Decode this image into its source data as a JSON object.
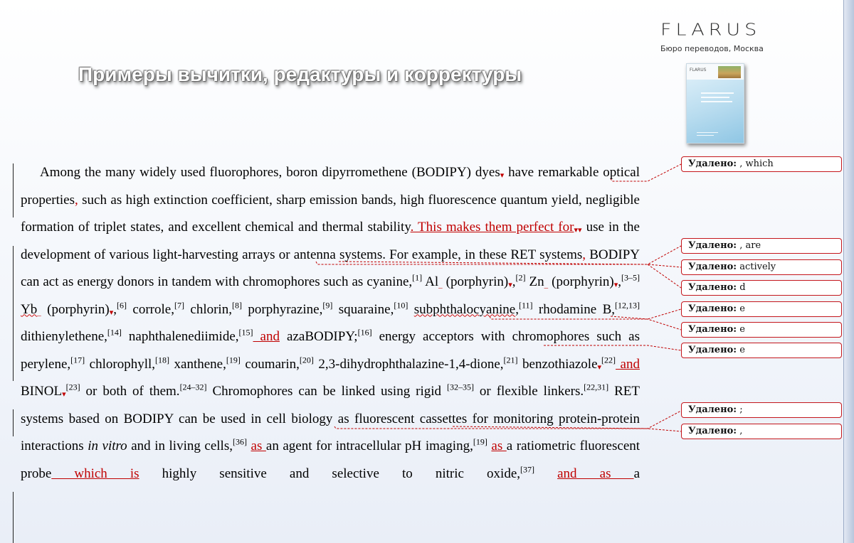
{
  "header": {
    "title": "Примеры вычитки, редактуры и корректуры",
    "logo_word": "FLARUS",
    "logo_sub": "Бюро переводов, Москва"
  },
  "colors": {
    "markup": "#c00000",
    "balloon_border": "#c4161c",
    "text": "#000000"
  },
  "balloon_label": "Удалено:",
  "balloons": [
    {
      "deleted": ", which"
    },
    {
      "deleted": ", are"
    },
    {
      "deleted": "actively"
    },
    {
      "deleted": "d"
    },
    {
      "deleted": "e"
    },
    {
      "deleted": "e"
    },
    {
      "deleted": "e"
    },
    {
      "deleted": ";"
    },
    {
      "deleted": ","
    }
  ],
  "doc": {
    "s1": "Among the many widely used fluorophores, boron dipyrromethene (BODIPY) dyes",
    "s2": " have remarkable optical properties",
    "i1": ",",
    "s3": " such as high extinction coefficient, sharp emission bands, high fluorescence quantum yield, negligible formation of triplet states, and excellent chemical and thermal stability",
    "i2": ". This makes them perfect for",
    "s4": " use in the development of various light-harvesting arrays or antenna systems. For example, in these RET systems",
    "i3": ",",
    "s5": " BODIPY can act as energy donors in tandem with chromophores such as cyanine,",
    "r1": "[1]",
    "s6": " Al",
    "s7": " (porphyrin)",
    "s8": ",",
    "r2": "[2]",
    "s9": " Zn",
    "s10": " (porphyrin)",
    "s11": ",",
    "r3": "[3–5]",
    "s12a": " ",
    "w1": "Yb",
    "s12b": " (porphyrin)",
    "s13": ",",
    "r4": "[6]",
    "s14": " corrole,",
    "r5": "[7]",
    "s15": " chlorin,",
    "r6": "[8]",
    "s16": " porphyrazine,",
    "r7": "[9]",
    "s17": " squaraine,",
    "r8": "[10]",
    "s18a": " ",
    "w2": "subphthalocyanine",
    "s18b": ",",
    "r9": "[11]",
    "s19": " rhodamine B,",
    "r10": "[12,13]",
    "s20": " dithienylethene,",
    "r11": "[14]",
    "s21": " naphthalenediimide,",
    "r12": "[15]",
    "i4": " and",
    "s22": " azaBODIPY;",
    "r13": "[16]",
    "s23": " energy acceptors with chromophores such as perylene,",
    "r14": "[17]",
    "s24": " chlorophyll,",
    "r15": "[18]",
    "s25": " xanthene,",
    "r16": "[19]",
    "s26": " coumarin,",
    "r17": "[20]",
    "s27": " 2,3-dihydrophthalazine-1,4-dione,",
    "r18": "[21]",
    "s28": " benzothiazole",
    "r19": "[22]",
    "i5": " and",
    "s29": " BINOL",
    "r20": "[23]",
    "s30": " or both of them.",
    "r21": "[24–32]",
    "s31": " Chromophores can be linked using rigid ",
    "r22": "[32–35]",
    "s32": " or flexible linkers.",
    "r23": "[22,31]",
    "s33": " RET systems based on BODIPY can be used in cell biology as fluorescent cassettes for monitoring protein-protein interactions ",
    "e1": "in vitro",
    "s34": " and in living cells,",
    "r24": "[36]",
    "s35": " ",
    "i6": "as ",
    "s36": "an agent for intracellular pH imaging,",
    "r25": "[19]",
    "s37": " ",
    "i7": "as ",
    "s38": "a ratiometric fluorescent probe",
    "i8": " which is",
    "s39": " highly sensitive and selective to nitric oxide,",
    "r26": "[37]",
    "s40": " ",
    "i9": "and as ",
    "s41": "a"
  }
}
